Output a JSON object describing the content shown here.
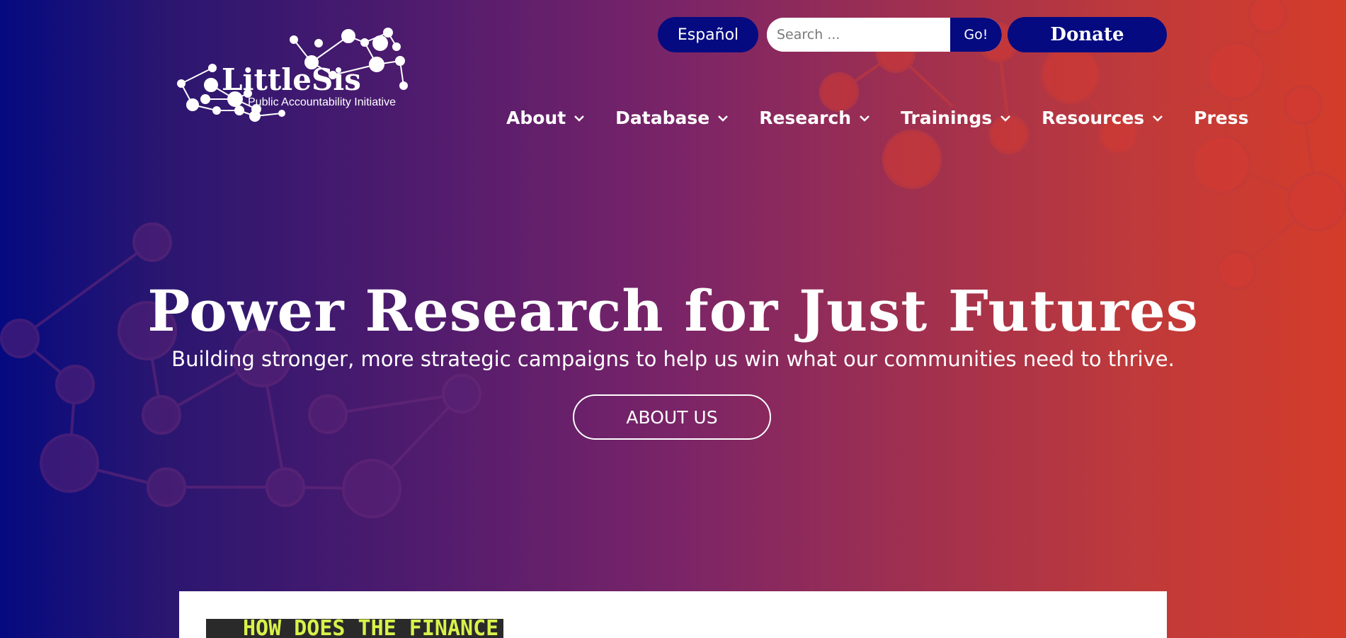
{
  "topbar": {
    "language_label": "Español",
    "search_placeholder": "Search ...",
    "search_button": "Go!",
    "donate_label": "Donate"
  },
  "logo": {
    "name": "LittleSis",
    "tagline": "Public Accountability Initiative"
  },
  "nav": {
    "items": [
      {
        "label": "About",
        "has_dropdown": true
      },
      {
        "label": "Database",
        "has_dropdown": true
      },
      {
        "label": "Research",
        "has_dropdown": true
      },
      {
        "label": "Trainings",
        "has_dropdown": true
      },
      {
        "label": "Resources",
        "has_dropdown": true
      },
      {
        "label": "Press",
        "has_dropdown": false
      }
    ]
  },
  "hero": {
    "title": "Power Research for Just Futures",
    "subtitle": "Building stronger, more strategic campaigns to help us win what our communities need to thrive.",
    "button_label": "ABOUT US"
  },
  "featured": {
    "image_text": "HOW DOES THE FINANCE"
  },
  "colors": {
    "navy": "#050a80",
    "gradient_start": "#050a80",
    "gradient_end": "#d43c2a",
    "accent_yellow": "#d9f24a"
  }
}
